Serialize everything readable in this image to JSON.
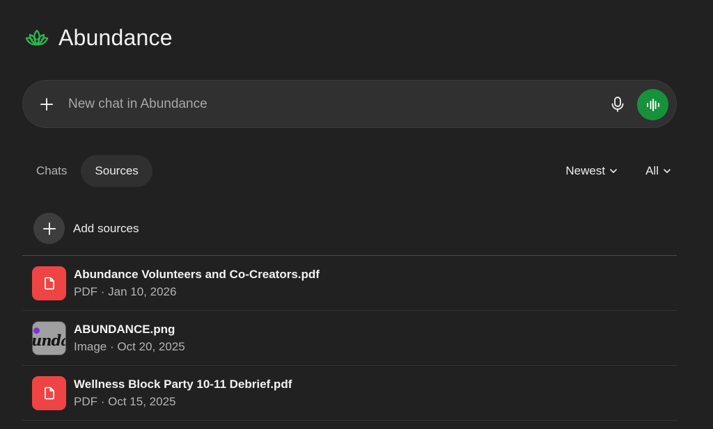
{
  "project": {
    "title": "Abundance",
    "icon": "lotus-icon",
    "accent": "#2eb350"
  },
  "composer": {
    "placeholder": "New chat in Abundance",
    "voice_color": "#17913b"
  },
  "tabs": [
    {
      "label": "Chats",
      "active": false
    },
    {
      "label": "Sources",
      "active": true
    }
  ],
  "filters": {
    "sort": "Newest",
    "type": "All"
  },
  "add_sources_label": "Add sources",
  "sources": [
    {
      "name": "Abundance Volunteers and Co-Creators.pdf",
      "kind": "PDF",
      "date": "Jan 10, 2026",
      "sep": "·",
      "icon": "pdf-file-icon",
      "thumb_word": ""
    },
    {
      "name": "ABUNDANCE.png",
      "kind": "Image",
      "date": "Oct 20, 2025",
      "sep": "·",
      "icon": "image-thumbnail",
      "thumb_word": "unda"
    },
    {
      "name": "Wellness Block Party 10-11 Debrief.pdf",
      "kind": "PDF",
      "date": "Oct 15, 2025",
      "sep": "·",
      "icon": "pdf-file-icon",
      "thumb_word": ""
    }
  ]
}
